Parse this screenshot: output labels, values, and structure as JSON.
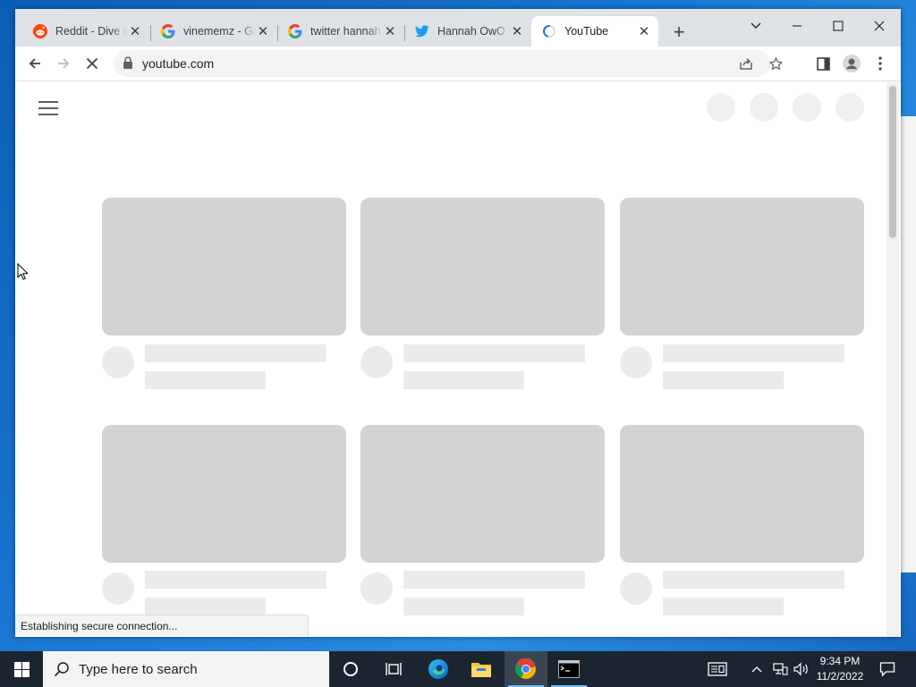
{
  "browser": {
    "tabs": [
      {
        "title": "Reddit - Dive into anything",
        "favicon": "reddit-icon",
        "active": false
      },
      {
        "title": "vinememz - Google Search",
        "favicon": "google-icon",
        "active": false
      },
      {
        "title": "twitter hannah - Google Search",
        "favicon": "google-icon",
        "active": false
      },
      {
        "title": "Hannah OwO (@hannah) / Twitter",
        "favicon": "twitter-icon",
        "active": false
      },
      {
        "title": "YouTube",
        "favicon": "loading-spinner-icon",
        "active": true
      }
    ],
    "address": "youtube.com",
    "status_text": "Establishing secure connection..."
  },
  "page": {
    "loading": true,
    "skeleton_cards": 6
  },
  "taskbar": {
    "search_placeholder": "Type here to search",
    "pinned": [
      "cortana-icon",
      "task-view-icon",
      "edge-icon",
      "file-explorer-icon",
      "chrome-icon",
      "terminal-icon"
    ],
    "active_app": "chrome-icon",
    "clock_time": "9:34 PM",
    "clock_date": "11/2/2022"
  },
  "colors": {
    "desktop": "#1976d2",
    "taskbar": "#1b2530",
    "skeleton_thumb": "#d3d3d3",
    "skeleton_text": "#ebebeb",
    "twitter": "#1d9bf0",
    "reddit": "#ff4500"
  }
}
